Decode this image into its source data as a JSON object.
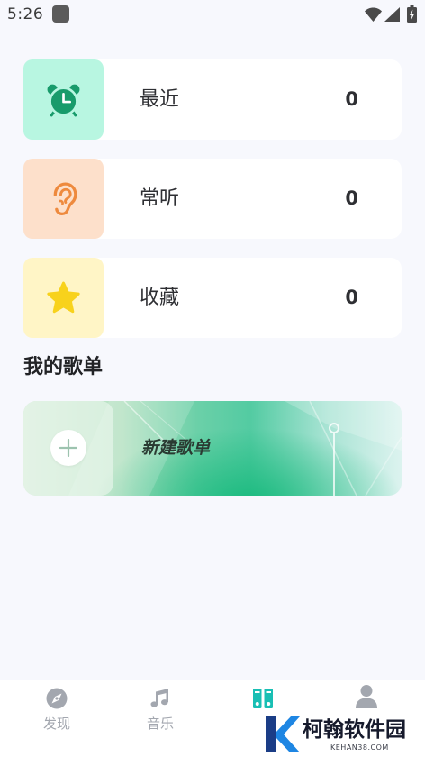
{
  "status_bar": {
    "time": "5:26",
    "icons": [
      "app-notification-icon",
      "wifi-icon",
      "signal-icon",
      "battery-charging-icon"
    ]
  },
  "theme": {
    "background": "#f7f8fd",
    "card": "#ffffff",
    "accent": "#19bfb4",
    "nav_inactive": "#a3a7af"
  },
  "quick_cards": [
    {
      "label": "最近",
      "count": "0",
      "icon": "alarm-clock-icon",
      "icon_bg": "#b8f6e1",
      "icon_color": "#189b6b"
    },
    {
      "label": "常听",
      "count": "0",
      "icon": "ear-icon",
      "icon_bg": "#fde0cb",
      "icon_color": "#ee8a3e"
    },
    {
      "label": "收藏",
      "count": "0",
      "icon": "star-icon",
      "icon_bg": "#fff5c6",
      "icon_color": "#f8d21c"
    }
  ],
  "playlists": {
    "title": "我的歌单",
    "create_label": "新建歌单",
    "create_icon": "plus-icon"
  },
  "bottom_nav": {
    "items": [
      {
        "label": "发现",
        "icon": "compass-icon",
        "active": false
      },
      {
        "label": "音乐",
        "icon": "music-note-icon",
        "active": false
      },
      {
        "icon": "library-icon",
        "active": true
      },
      {
        "icon": "person-icon",
        "active": false
      }
    ]
  },
  "watermark": {
    "name": "柯翰软件园",
    "domain": "KEHAN38.COM",
    "logo": "k-logo-icon"
  }
}
